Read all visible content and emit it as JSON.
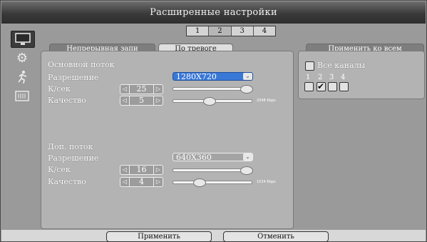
{
  "title": "Расширенные настройки",
  "page_tabs": [
    "1",
    "2",
    "3",
    "4"
  ],
  "tabs": {
    "continuous": "Непрерывная запи",
    "alarm": "По тревоге"
  },
  "apply_all_tab": "Применить ко всем",
  "sidebar": [
    "monitor-icon",
    "gear-icon",
    "running-figure-icon",
    "network-icon"
  ],
  "main_stream": {
    "header": "Основной поток",
    "resolution_label": "Разрешение",
    "resolution_value": "1280X720",
    "fps_label": "К/сек",
    "fps_value": "25",
    "quality_label": "Качество",
    "quality_value": "5",
    "fps_slider_level": 1.0,
    "quality_slider_level": 0.45,
    "bitrate": "2048 Kbps"
  },
  "sub_stream": {
    "header": "Доп. поток",
    "resolution_label": "Разрешение",
    "resolution_value": "640X360",
    "fps_label": "К/сек",
    "fps_value": "16",
    "quality_label": "Качество",
    "quality_value": "4",
    "fps_slider_level": 1.0,
    "quality_slider_level": 0.3,
    "bitrate": "1024 Kbps"
  },
  "all_channels_label": "Все каналы",
  "channels": [
    {
      "num": "1",
      "checked": false
    },
    {
      "num": "2",
      "checked": true
    },
    {
      "num": "3",
      "checked": false
    },
    {
      "num": "4",
      "checked": false
    }
  ],
  "buttons": {
    "apply": "Применить",
    "cancel": "Отменить"
  },
  "colors": {
    "highlight": "#3a78d6",
    "background": "#9a9a9a"
  }
}
